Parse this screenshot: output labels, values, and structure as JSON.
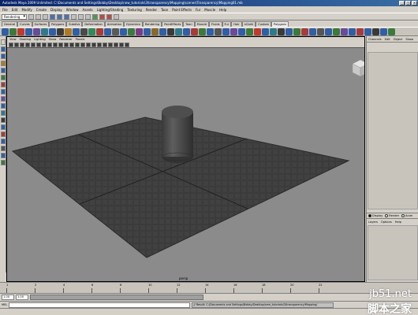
{
  "window": {
    "title": "Autodesk Maya 2009 Unlimited: C:\\Documents and Settings\\Bobby\\Desktop\\new_tutorials\\3\\transparency\\Mapping\\scenes\\Transparency\\Mapping01.mb",
    "controls": [
      "_",
      "□",
      "×"
    ]
  },
  "menu": [
    "File",
    "Edit",
    "Modify",
    "Create",
    "Display",
    "Window",
    "Assets",
    "Lighting/Shading",
    "Texturing",
    "Render",
    "Toon",
    "Paint Effects",
    "Fur",
    "Muscle",
    "Help"
  ],
  "status_line": {
    "menu_set": "Rendering"
  },
  "shelf_tabs": [
    "General",
    "Curves",
    "Surfaces",
    "Polygons",
    "Subdivs",
    "Deformation",
    "Animation",
    "Dynamics",
    "Rendering",
    "PaintEffects",
    "Toon",
    "Muscle",
    "Fluids",
    "Fur",
    "Hair",
    "nCloth",
    "Custom",
    "Polygons"
  ],
  "panel": {
    "menu": [
      "View",
      "Shading",
      "Lighting",
      "Show",
      "Renderer",
      "Panels"
    ],
    "camera_label": "persp"
  },
  "channel_box": {
    "tabs": [
      "Channels",
      "Edit",
      "Object",
      "Show"
    ],
    "layer_modes": [
      "Display",
      "Render",
      "Anim"
    ],
    "layer_menu": [
      "Layers",
      "Options",
      "Help"
    ]
  },
  "time_slider": {
    "ticks": [
      "1",
      "2",
      "4",
      "6",
      "8",
      "10",
      "12",
      "14",
      "16",
      "18",
      "20",
      "22"
    ]
  },
  "range": {
    "start": "1.00",
    "end": "1.00"
  },
  "command_line": {
    "label": "MEL",
    "result": "// Result: C:/Documents and Settings/Bobby/Desktop/new_tutorials/3/transparency/Mapping/"
  },
  "watermark": {
    "line1": "jb51.net",
    "line2": "脚本之家"
  },
  "colors": {
    "viewport_bg": "#8b8b8b",
    "plane": "#3a3a3a",
    "title_blue": "#0a246a"
  }
}
